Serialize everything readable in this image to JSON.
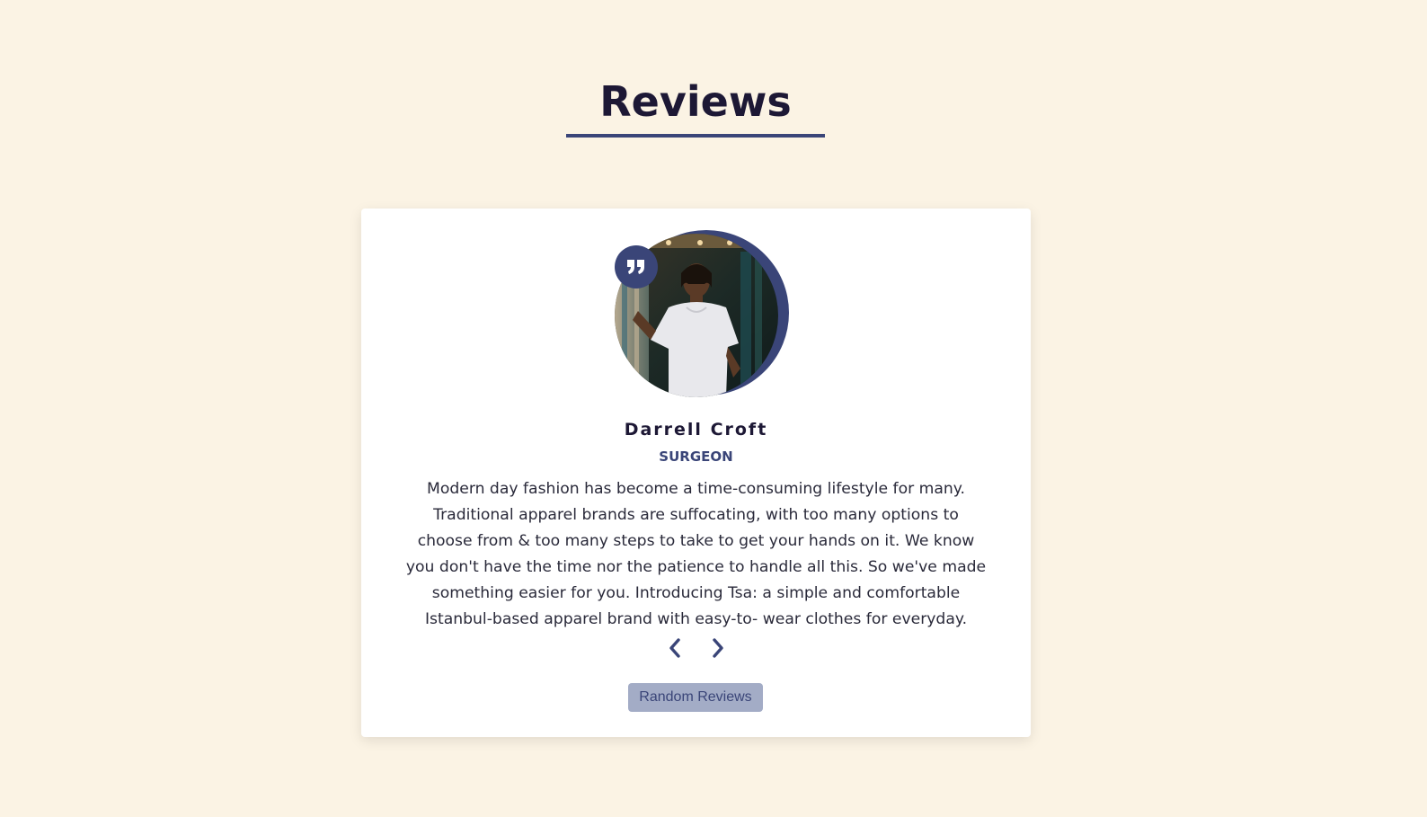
{
  "page": {
    "title": "Reviews"
  },
  "review": {
    "name": "Darrell Croft",
    "job": "SURGEON",
    "text": "Modern day fashion has become a time-consuming lifestyle for many. Traditional apparel brands are suffocating, with too many options to choose from & too many steps to take to get your hands on it. We know you don't have the time nor the patience to handle all this. So we've made something easier for you. Introducing Tsa: a simple and comfortable Istanbul-based apparel brand with easy-to- wear clothes for everyday.",
    "avatar_icon": "person-photo",
    "badge_icon": "quote-icon"
  },
  "controls": {
    "prev_icon": "chevron-left-icon",
    "next_icon": "chevron-right-icon",
    "random_label": "Random Reviews"
  },
  "colors": {
    "background": "#fbf3e4",
    "accent": "#3a4578",
    "heading": "#1d1835",
    "button_bg": "#a3acc6"
  }
}
